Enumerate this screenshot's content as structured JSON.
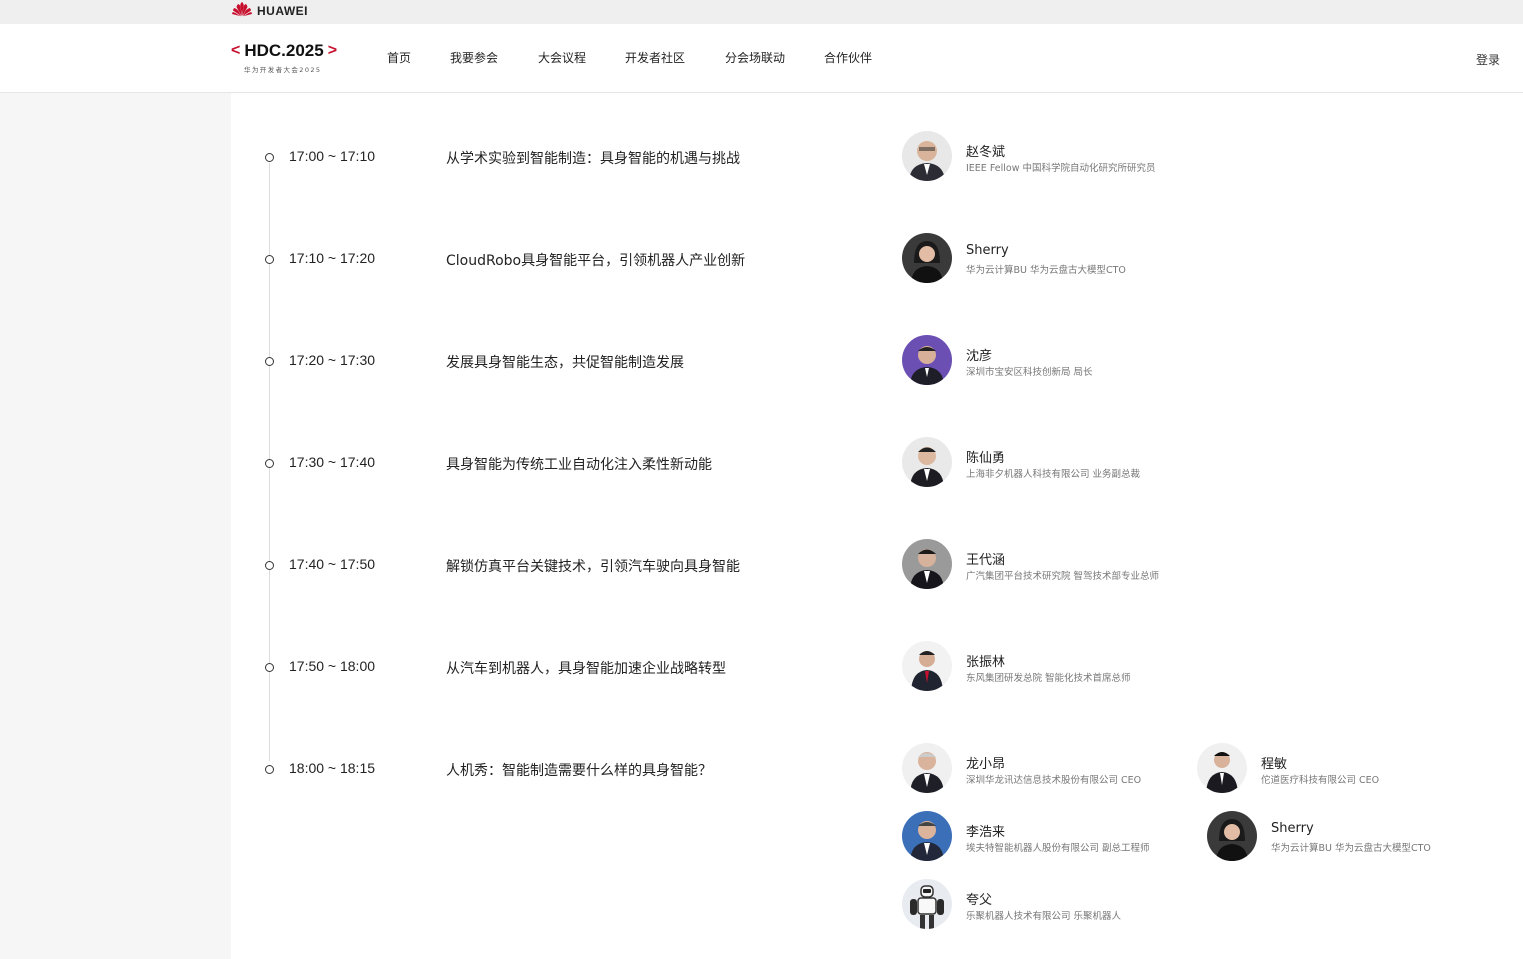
{
  "topbar": {
    "brand_name": "HUAWEI",
    "brand_color": "#c8102e"
  },
  "nav": {
    "logo_text": "HDC.2025",
    "logo_left": "<",
    "logo_right": ">",
    "logo_sub": "华为开发者大会2025",
    "items": [
      "首页",
      "我要参会",
      "大会议程",
      "开发者社区",
      "分会场联动",
      "合作伙伴"
    ],
    "login": "登录"
  },
  "agenda": [
    {
      "time": "17:00 ~ 17:10",
      "topic": "从学术实验到智能制造：具身智能的机遇与挑战",
      "speakers": [
        {
          "name": "赵冬斌",
          "title": "IEEE Fellow 中国科学院自动化研究所研究员",
          "avatar_bg": "#e8e8e8"
        }
      ]
    },
    {
      "time": "17:10 ~ 17:20",
      "topic": "CloudRobo具身智能平台，引领机器人产业创新",
      "speakers": [
        {
          "name": "Sherry",
          "title": "华为云计算BU 华为云盘古大模型CTO",
          "avatar_bg": "#3a3a3a"
        }
      ]
    },
    {
      "time": "17:20 ~ 17:30",
      "topic": "发展具身智能生态，共促智能制造发展",
      "speakers": [
        {
          "name": "沈彦",
          "title": "深圳市宝安区科技创新局 局长",
          "avatar_bg": "#6b4fb3"
        }
      ]
    },
    {
      "time": "17:30 ~ 17:40",
      "topic": "具身智能为传统工业自动化注入柔性新动能",
      "speakers": [
        {
          "name": "陈仙勇",
          "title": "上海非夕机器人科技有限公司 业务副总裁",
          "avatar_bg": "#e9e9e9"
        }
      ]
    },
    {
      "time": "17:40 ~ 17:50",
      "topic": "解锁仿真平台关键技术，引领汽车驶向具身智能",
      "speakers": [
        {
          "name": "王代涵",
          "title": "广汽集团平台技术研究院 智驾技术部专业总师",
          "avatar_bg": "#9a9a9a"
        }
      ]
    },
    {
      "time": "17:50 ~ 18:00",
      "topic": "从汽车到机器人，具身智能加速企业战略转型",
      "speakers": [
        {
          "name": "张振林",
          "title": "东风集团研发总院 智能化技术首席总师",
          "avatar_bg": "#f2f2f2"
        }
      ]
    },
    {
      "time": "18:00 ~ 18:15",
      "topic": "人机秀：智能制造需要什么样的具身智能？",
      "speakers": [
        {
          "name": "龙小昂",
          "title": "深圳华龙讯达信息技术股份有限公司 CEO",
          "avatar_bg": "#f0f0f0"
        },
        {
          "name": "程敏",
          "title": "佗道医疗科技有限公司 CEO",
          "avatar_bg": "#f0f0f0"
        },
        {
          "name": "李浩来",
          "title": "埃夫特智能机器人股份有限公司 副总工程师",
          "avatar_bg": "#3b6fb8"
        },
        {
          "name": "Sherry",
          "title": "华为云计算BU 华为云盘古大模型CTO",
          "avatar_bg": "#3a3a3a"
        },
        {
          "name": "夸父",
          "title": "乐聚机器人技术有限公司 乐聚机器人",
          "avatar_bg": "#e8ecf0"
        }
      ]
    }
  ]
}
